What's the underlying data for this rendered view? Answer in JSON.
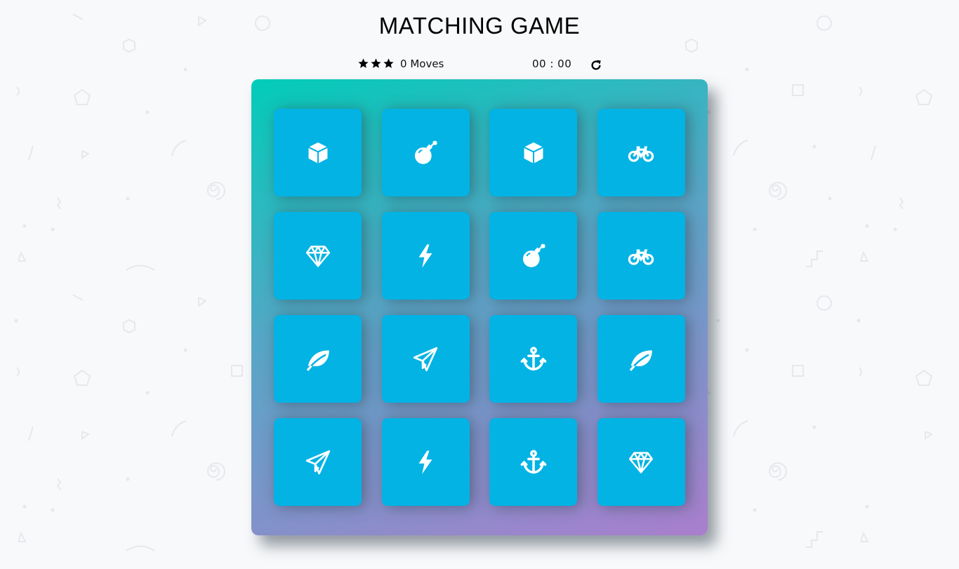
{
  "title": "MATCHING GAME",
  "score": {
    "stars": 3,
    "moves": "0",
    "moves_label": "Moves",
    "timer": "00 : 00"
  },
  "colors": {
    "card": "#02b3e4",
    "deck_gradient_start": "#02ccba",
    "deck_gradient_end": "#aa7ecd",
    "background": "#f8f9fb"
  },
  "cards": [
    {
      "icon": "cube-icon"
    },
    {
      "icon": "bomb-icon"
    },
    {
      "icon": "cube-icon"
    },
    {
      "icon": "bicycle-icon"
    },
    {
      "icon": "diamond-icon"
    },
    {
      "icon": "bolt-icon"
    },
    {
      "icon": "bomb-icon"
    },
    {
      "icon": "bicycle-icon"
    },
    {
      "icon": "leaf-icon"
    },
    {
      "icon": "paper-plane-icon"
    },
    {
      "icon": "anchor-icon"
    },
    {
      "icon": "leaf-icon"
    },
    {
      "icon": "paper-plane-icon"
    },
    {
      "icon": "bolt-icon"
    },
    {
      "icon": "anchor-icon"
    },
    {
      "icon": "diamond-icon"
    }
  ]
}
